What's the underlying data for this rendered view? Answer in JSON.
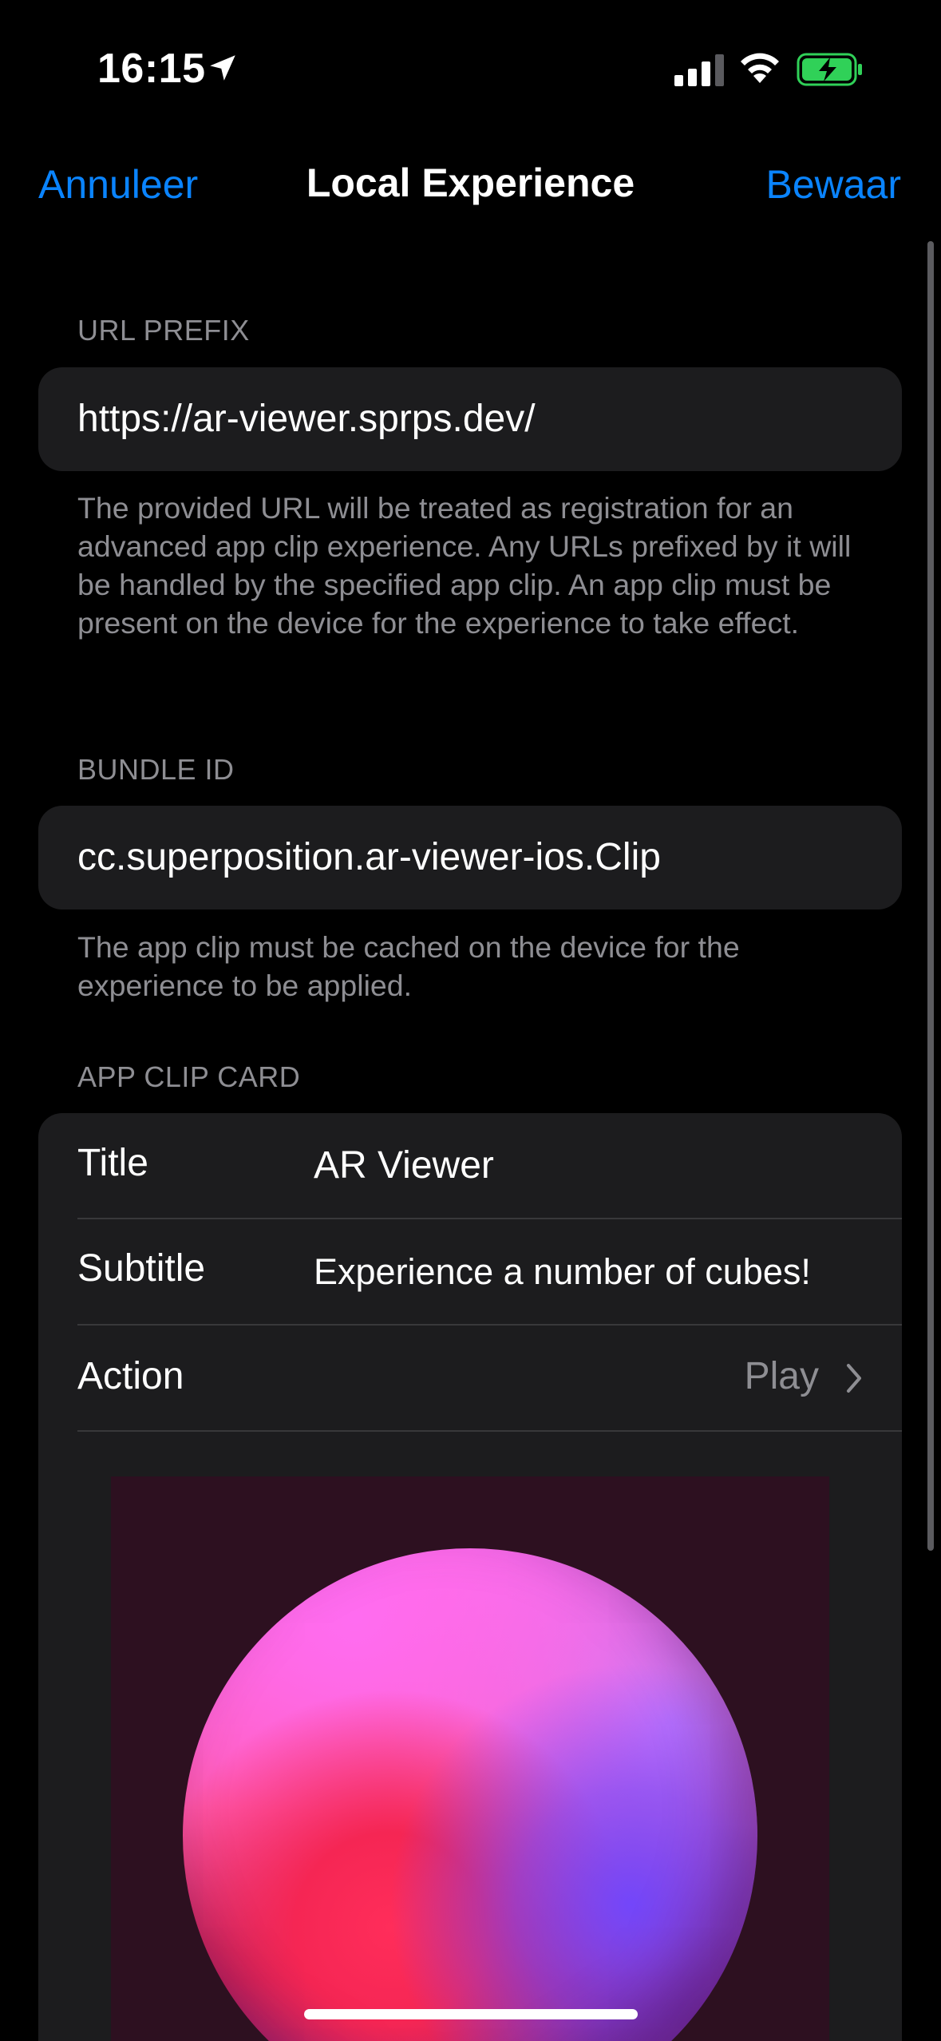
{
  "status_bar": {
    "time": "16:15",
    "icons": [
      "location-arrow-icon",
      "cellular-signal-icon",
      "wifi-icon",
      "battery-charging-icon"
    ]
  },
  "nav": {
    "cancel_label": "Annuleer",
    "title": "Local Experience",
    "save_label": "Bewaar"
  },
  "url_prefix": {
    "header": "URL PREFIX",
    "value": "https://ar-viewer.sprps.dev/",
    "footer": "The provided URL will be treated as registration for an advanced app clip experience. Any URLs prefixed by it will be handled by the specified app clip. An app clip must be present on the device for the experience to take effect."
  },
  "bundle_id": {
    "header": "BUNDLE ID",
    "value": "cc.superposition.ar-viewer-ios.Clip",
    "footer": "The app clip must be cached on the device for the experience to be applied."
  },
  "app_clip_card": {
    "header": "APP CLIP CARD",
    "rows": [
      {
        "label": "Title",
        "value": "AR Viewer"
      },
      {
        "label": "Subtitle",
        "value": "Experience a number of cubes!"
      },
      {
        "label": "Action",
        "value": "Play"
      }
    ]
  },
  "colors": {
    "accent": "#0a84ff",
    "background": "#000000",
    "cell": "#1c1c1e",
    "secondary_text": "#8e8e93",
    "battery_charging": "#30d158"
  }
}
